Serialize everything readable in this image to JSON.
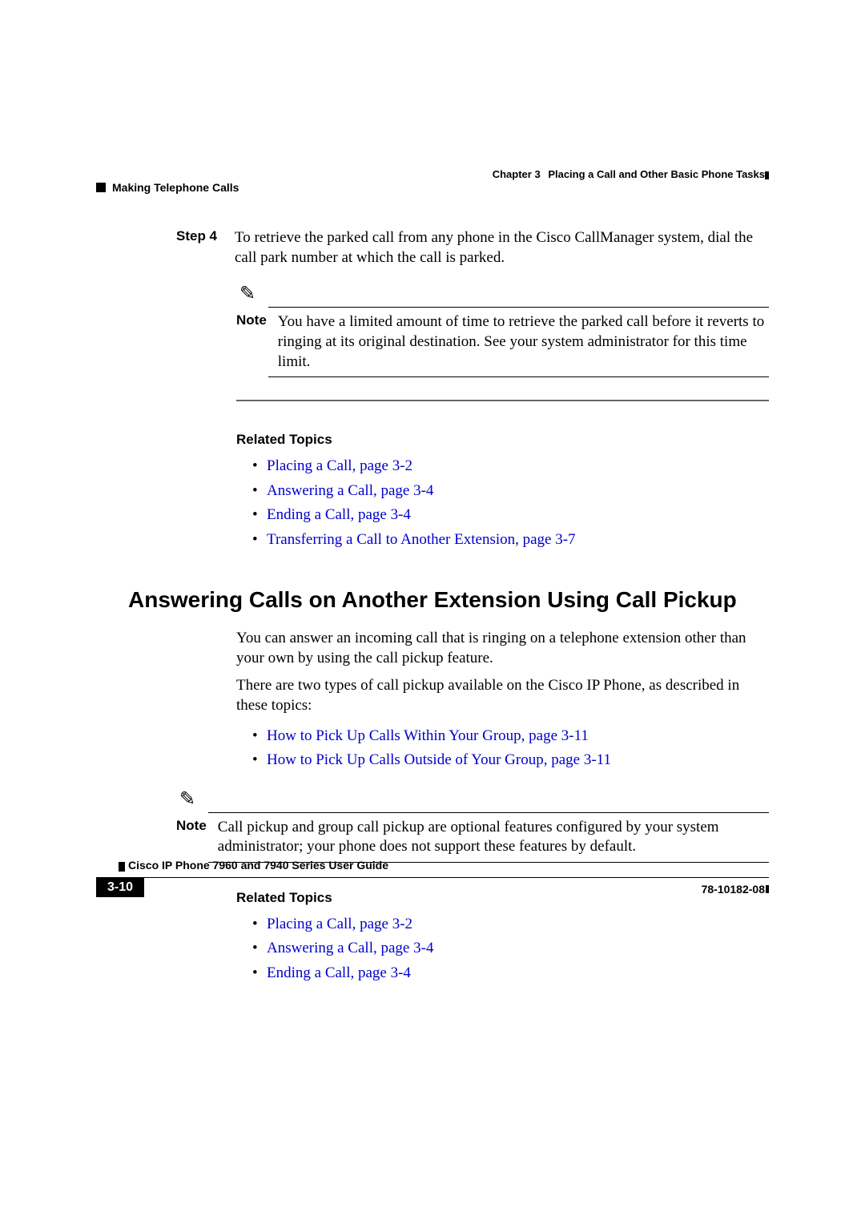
{
  "header": {
    "chapter_label": "Chapter 3",
    "chapter_title": "Placing a Call and Other Basic Phone Tasks",
    "section_title": "Making Telephone Calls"
  },
  "step": {
    "label": "Step 4",
    "text": "To retrieve the parked call from any phone in the Cisco CallManager system, dial the call park number at which the call is parked."
  },
  "note1": {
    "label": "Note",
    "text": "You have a limited amount of time to retrieve the parked call before it reverts to ringing at its original destination. See your system administrator for this time limit."
  },
  "related1": {
    "heading": "Related Topics",
    "items": [
      "Placing a Call, page 3-2",
      "Answering a Call, page 3-4",
      "Ending a Call, page 3-4",
      "Transferring a Call to Another Extension, page 3-7"
    ]
  },
  "h1": "Answering Calls on Another Extension Using Call Pickup",
  "para1": "You can answer an incoming call that is ringing on a telephone extension other than your own by using the call pickup feature.",
  "para2": "There are two types of call pickup available on the Cisco IP Phone, as described in these topics:",
  "topic_links": [
    "How to Pick Up Calls Within Your Group, page 3-11",
    "How to Pick Up Calls Outside of Your Group, page 3-11"
  ],
  "note2": {
    "label": "Note",
    "text": "Call pickup and group call pickup are optional features configured by your system administrator; your phone does not support these features by default."
  },
  "related2": {
    "heading": "Related Topics",
    "items": [
      "Placing a Call, page 3-2",
      "Answering a Call, page 3-4",
      "Ending a Call, page 3-4"
    ]
  },
  "footer": {
    "guide_title": "Cisco IP Phone 7960 and 7940 Series User Guide",
    "page_number": "3-10",
    "doc_number": "78-10182-08"
  }
}
